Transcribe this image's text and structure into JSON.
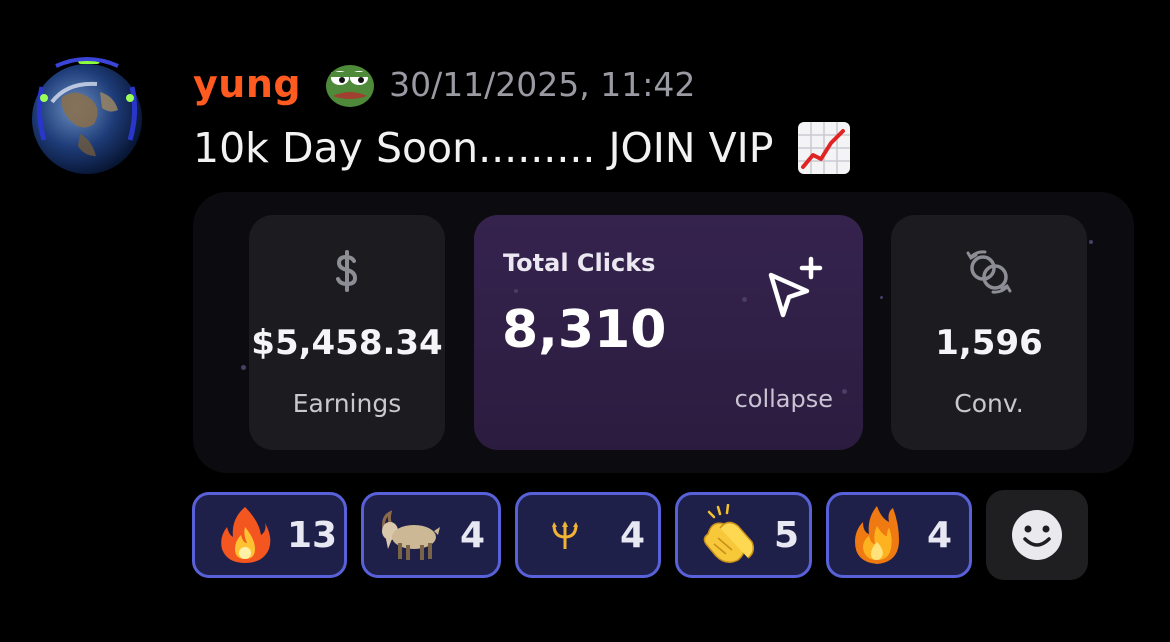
{
  "message": {
    "username": "yung",
    "timestamp": "30/11/2025, 11:42",
    "text": "10k Day Soon......... JOIN VIP",
    "avatar_icon": "earth-globe-avatar",
    "badge_icon": "pepe-frog-icon",
    "inline_emoji": "chart-increasing-icon",
    "colors": {
      "username": "#ff5a1f",
      "timestamp": "#9a9aa3",
      "reaction_border": "#5961d9",
      "reaction_bg": "#1f204a"
    }
  },
  "embed": {
    "earnings": {
      "icon": "dollar-icon",
      "value": "$5,458.34",
      "label": "Earnings"
    },
    "clicks": {
      "label": "Total Clicks",
      "value": "8,310",
      "icon": "cursor-plus-icon",
      "toggle": "collapse"
    },
    "conversions": {
      "icon": "conversion-icon",
      "value": "1,596",
      "label": "Conv."
    }
  },
  "reactions": [
    {
      "emoji": "fire",
      "count": "13"
    },
    {
      "emoji": "goat",
      "count": "4"
    },
    {
      "emoji": "trident",
      "count": "4"
    },
    {
      "emoji": "clapping-hands",
      "count": "5"
    },
    {
      "emoji": "flame",
      "count": "4"
    }
  ],
  "add_reaction_icon": "smiley-face-icon"
}
